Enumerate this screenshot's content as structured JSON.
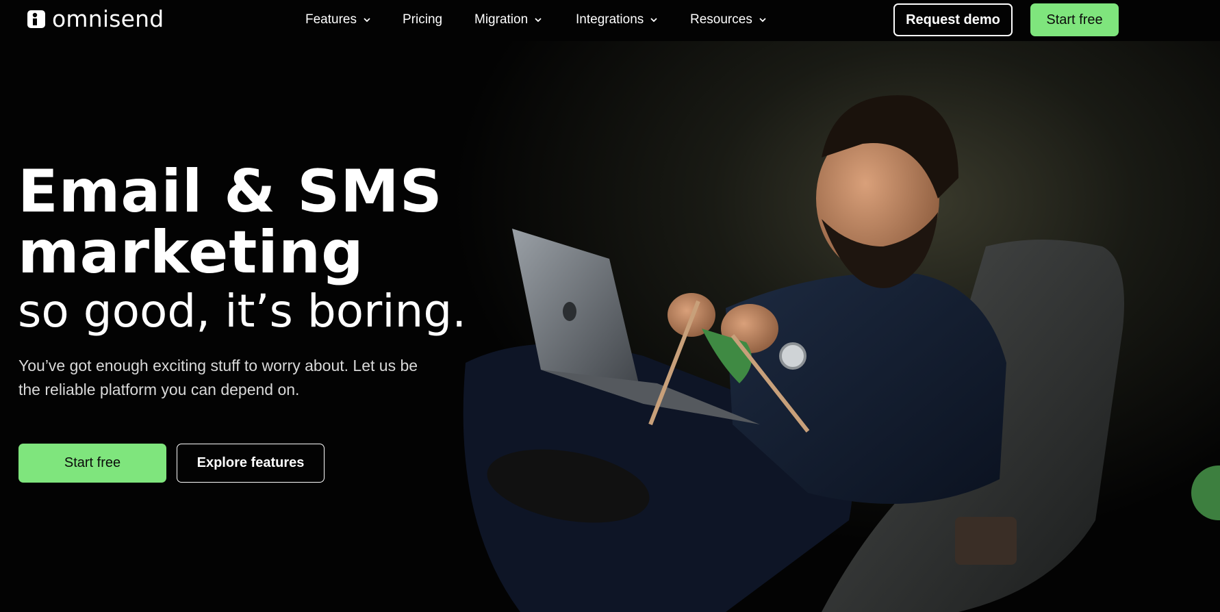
{
  "brand": {
    "name": "omnisend",
    "logo_icon": "omnisend-logo-icon",
    "accent_color": "#7fe57d",
    "background_color": "#030303"
  },
  "nav": {
    "items": [
      {
        "label": "Features",
        "has_dropdown": true
      },
      {
        "label": "Pricing",
        "has_dropdown": false
      },
      {
        "label": "Migration",
        "has_dropdown": true
      },
      {
        "label": "Integrations",
        "has_dropdown": true
      },
      {
        "label": "Resources",
        "has_dropdown": true
      }
    ],
    "dropdown_icon": "chevron-down-icon"
  },
  "header_actions": {
    "request_demo_label": "Request demo",
    "start_free_label": "Start free"
  },
  "hero": {
    "headline_line1": "Email & SMS",
    "headline_line2": "marketing",
    "headline_sub": "so good, it’s boring.",
    "lead": "You’ve got enough exciting stuff to worry about. Let us be the reliable platform you can depend on.",
    "primary_cta": "Start free",
    "secondary_cta": "Explore features"
  }
}
